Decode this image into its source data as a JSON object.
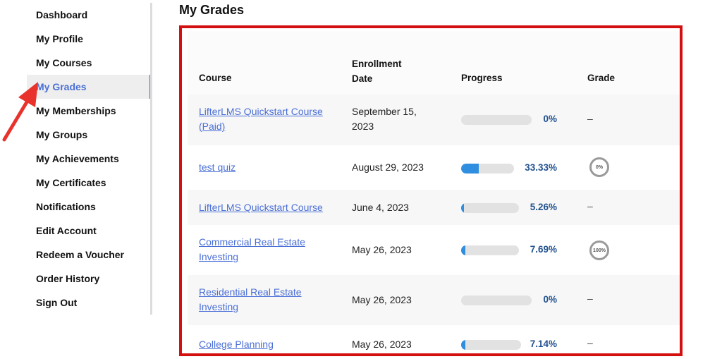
{
  "sidebar": {
    "items": [
      {
        "label": "Dashboard",
        "active": false
      },
      {
        "label": "My Profile",
        "active": false
      },
      {
        "label": "My Courses",
        "active": false
      },
      {
        "label": "My Grades",
        "active": true
      },
      {
        "label": "My Memberships",
        "active": false
      },
      {
        "label": "My Groups",
        "active": false
      },
      {
        "label": "My Achievements",
        "active": false
      },
      {
        "label": "My Certificates",
        "active": false
      },
      {
        "label": "Notifications",
        "active": false
      },
      {
        "label": "Edit Account",
        "active": false
      },
      {
        "label": "Redeem a Voucher",
        "active": false
      },
      {
        "label": "Order History",
        "active": false
      },
      {
        "label": "Sign Out",
        "active": false
      }
    ]
  },
  "page": {
    "title": "My Grades"
  },
  "table": {
    "headers": {
      "course": "Course",
      "enrollment_line1": "Enrollment",
      "enrollment_line2": "Date",
      "progress": "Progress",
      "grade": "Grade"
    },
    "rows": [
      {
        "course_line1": "LifterLMS Quickstart Course",
        "course_line2": "(Paid)",
        "date_line1": "September 15,",
        "date_line2": "2023",
        "progress": 0,
        "progress_label": "0%",
        "grade": "–",
        "grade_type": "dash"
      },
      {
        "course_line1": "test quiz",
        "course_line2": "",
        "date_line1": "August 29, 2023",
        "date_line2": "",
        "progress": 33.33,
        "progress_label": "33.33%",
        "grade": "0%",
        "grade_type": "circle"
      },
      {
        "course_line1": "LifterLMS Quickstart Course",
        "course_line2": "",
        "date_line1": "June 4, 2023",
        "date_line2": "",
        "progress": 5.26,
        "progress_label": "5.26%",
        "grade": "–",
        "grade_type": "dash"
      },
      {
        "course_line1": "Commercial Real Estate",
        "course_line2": "Investing",
        "date_line1": "May 26, 2023",
        "date_line2": "",
        "progress": 7.69,
        "progress_label": "7.69%",
        "grade": "100%",
        "grade_type": "circle"
      },
      {
        "course_line1": "Residential Real Estate",
        "course_line2": "Investing",
        "date_line1": "May 26, 2023",
        "date_line2": "",
        "progress": 0,
        "progress_label": "0%",
        "grade": "–",
        "grade_type": "dash"
      },
      {
        "course_line1": "College Planning",
        "course_line2": "",
        "date_line1": "May 26, 2023",
        "date_line2": "",
        "progress": 7.14,
        "progress_label": "7.14%",
        "grade": "–",
        "grade_type": "dash"
      }
    ]
  },
  "colors": {
    "accent": "#4a6fd6",
    "highlight_border": "#d30f0f",
    "progress_fill": "#2f8ee0",
    "progress_text": "#23528f"
  }
}
